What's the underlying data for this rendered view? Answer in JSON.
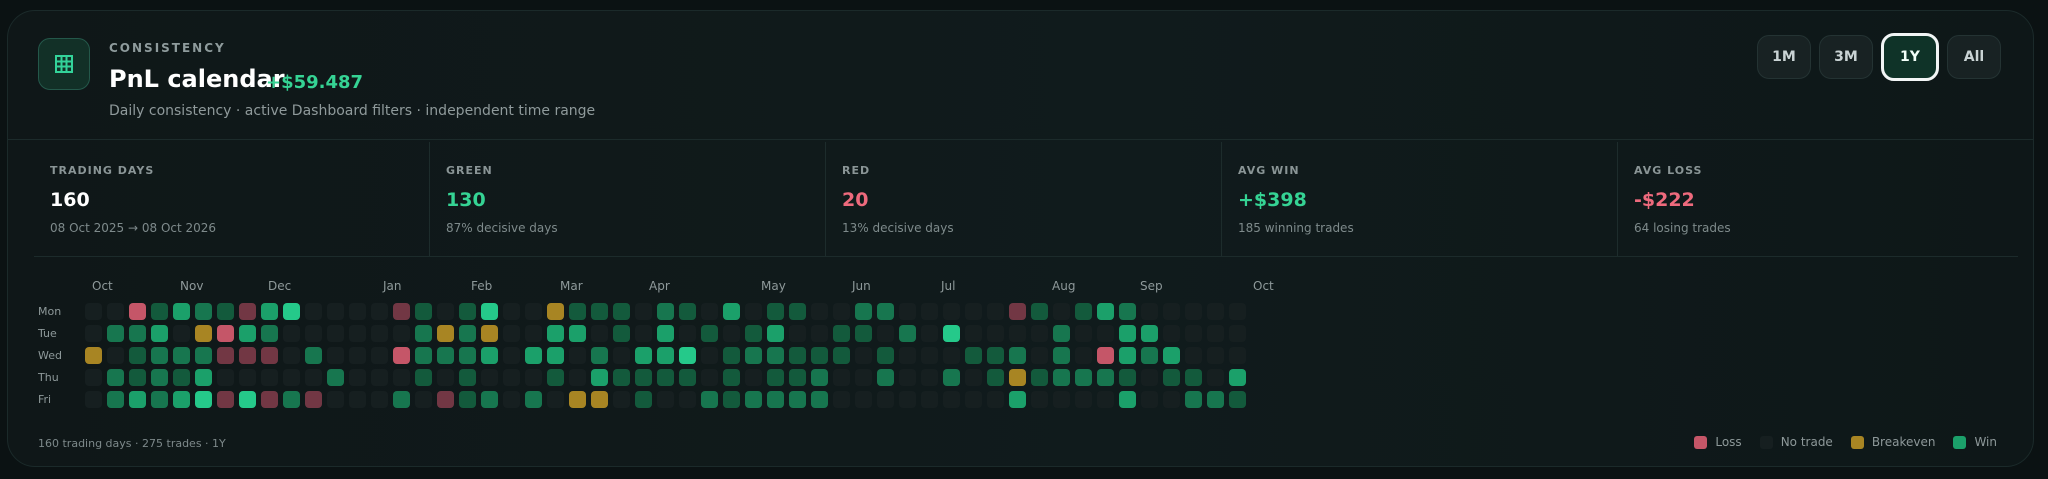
{
  "header": {
    "eyebrow": "CONSISTENCY",
    "title": "PnL calendar",
    "pnl": "+$59.487",
    "subtitle": "Daily consistency · active Dashboard filters · independent time range",
    "icon": "calendar-grid-icon"
  },
  "ranges": [
    {
      "label": "1M",
      "active": false
    },
    {
      "label": "3M",
      "active": false
    },
    {
      "label": "1Y",
      "active": true
    },
    {
      "label": "All",
      "active": false
    }
  ],
  "stats": [
    {
      "label": "TRADING DAYS",
      "value": "160",
      "sub": "08 Oct 2025 → 08 Oct 2026",
      "color": "#ffffff"
    },
    {
      "label": "GREEN",
      "value": "130",
      "sub": "87% decisive days",
      "color": "#35d394"
    },
    {
      "label": "RED",
      "value": "20",
      "sub": "13% decisive days",
      "color": "#ee6a7d"
    },
    {
      "label": "AVG WIN",
      "value": "+$398",
      "sub": "185 winning trades",
      "color": "#35d394"
    },
    {
      "label": "AVG LOSS",
      "value": "-$222",
      "sub": "64 losing trades",
      "color": "#ee6a7d"
    }
  ],
  "heatmap": {
    "months": [
      "Oct",
      "Nov",
      "Dec",
      "Jan",
      "Feb",
      "Mar",
      "Apr",
      "May",
      "Jun",
      "Jul",
      "Aug",
      "Sep",
      "Oct"
    ],
    "days": [
      "Mon",
      "Tue",
      "Wed",
      "Thu",
      "Fri"
    ],
    "rows": [
      "00L1321l340000l101400b11102103011002200000l10132000000000",
      "02230bL320000002b2b00330103010130011020400002003300000000",
      "b01222lll02000L2223033020334012211101000112020L3230000220",
      "021213000002000101000103111101011200200201b12221011030400",
      "023234l4l2l00020l12020bb0100212222000000003000030022110000"
    ]
  },
  "footer": "160 trading days · 275 trades · 1Y",
  "legend": [
    {
      "label": "Loss",
      "color": "#c55668"
    },
    {
      "label": "No trade",
      "color": "#161f20"
    },
    {
      "label": "Breakeven",
      "color": "#a88523"
    },
    {
      "label": "Win",
      "color": "#1ba06a"
    }
  ]
}
